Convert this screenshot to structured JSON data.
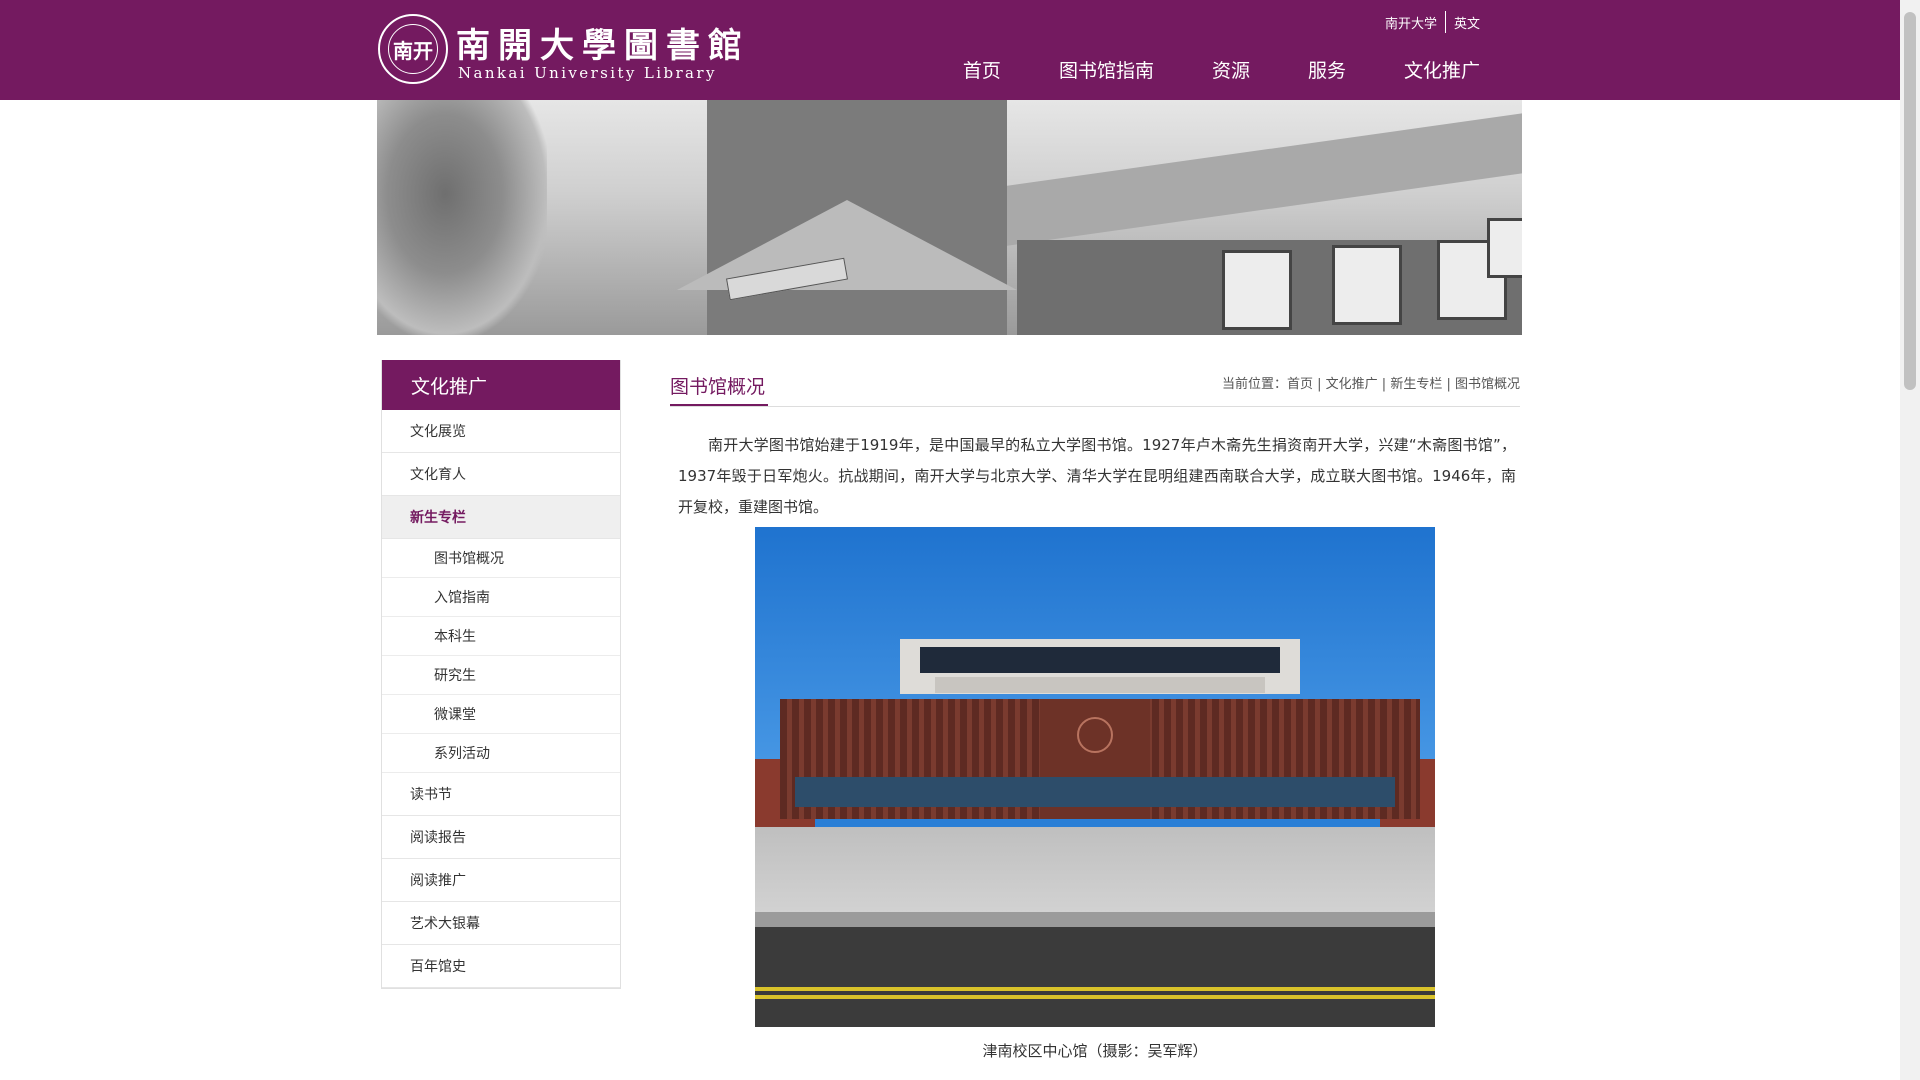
{
  "header": {
    "logo_cn": "南開大學圖書館",
    "logo_en": "Nankai University Library",
    "seal_glyph": "南开",
    "top_links": [
      "南开大学",
      "英文"
    ],
    "nav": [
      "首页",
      "图书馆指南",
      "资源",
      "服务",
      "文化推广"
    ]
  },
  "sidebar": {
    "title": "文化推广",
    "items_before": [
      "文化展览",
      "文化育人"
    ],
    "active": "新生专栏",
    "subitems": [
      "图书馆概况",
      "入馆指南",
      "本科生",
      "研究生",
      "微课堂",
      "系列活动"
    ],
    "items_after": [
      "读书节",
      "阅读报告",
      "阅读推广",
      "艺术大银幕",
      "百年馆史"
    ]
  },
  "main": {
    "title": "图书馆概况",
    "breadcrumb_prefix": "当前位置：",
    "breadcrumb": [
      "首页",
      "文化推广",
      "新生专栏",
      "图书馆概况"
    ],
    "paragraph": "南开大学图书馆始建于1919年，是中国最早的私立大学图书馆。1927年卢木斋先生捐资南开大学，兴建“木斋图书馆”，1937年毁于日军炮火。抗战期间，南开大学与北京大学、清华大学在昆明组建西南联合大学，成立联大图书馆。1946年，南开复校，重建图书馆。",
    "caption": "津南校区中心馆（摄影：吴军辉）"
  },
  "colors": {
    "brand": "#741a60"
  }
}
